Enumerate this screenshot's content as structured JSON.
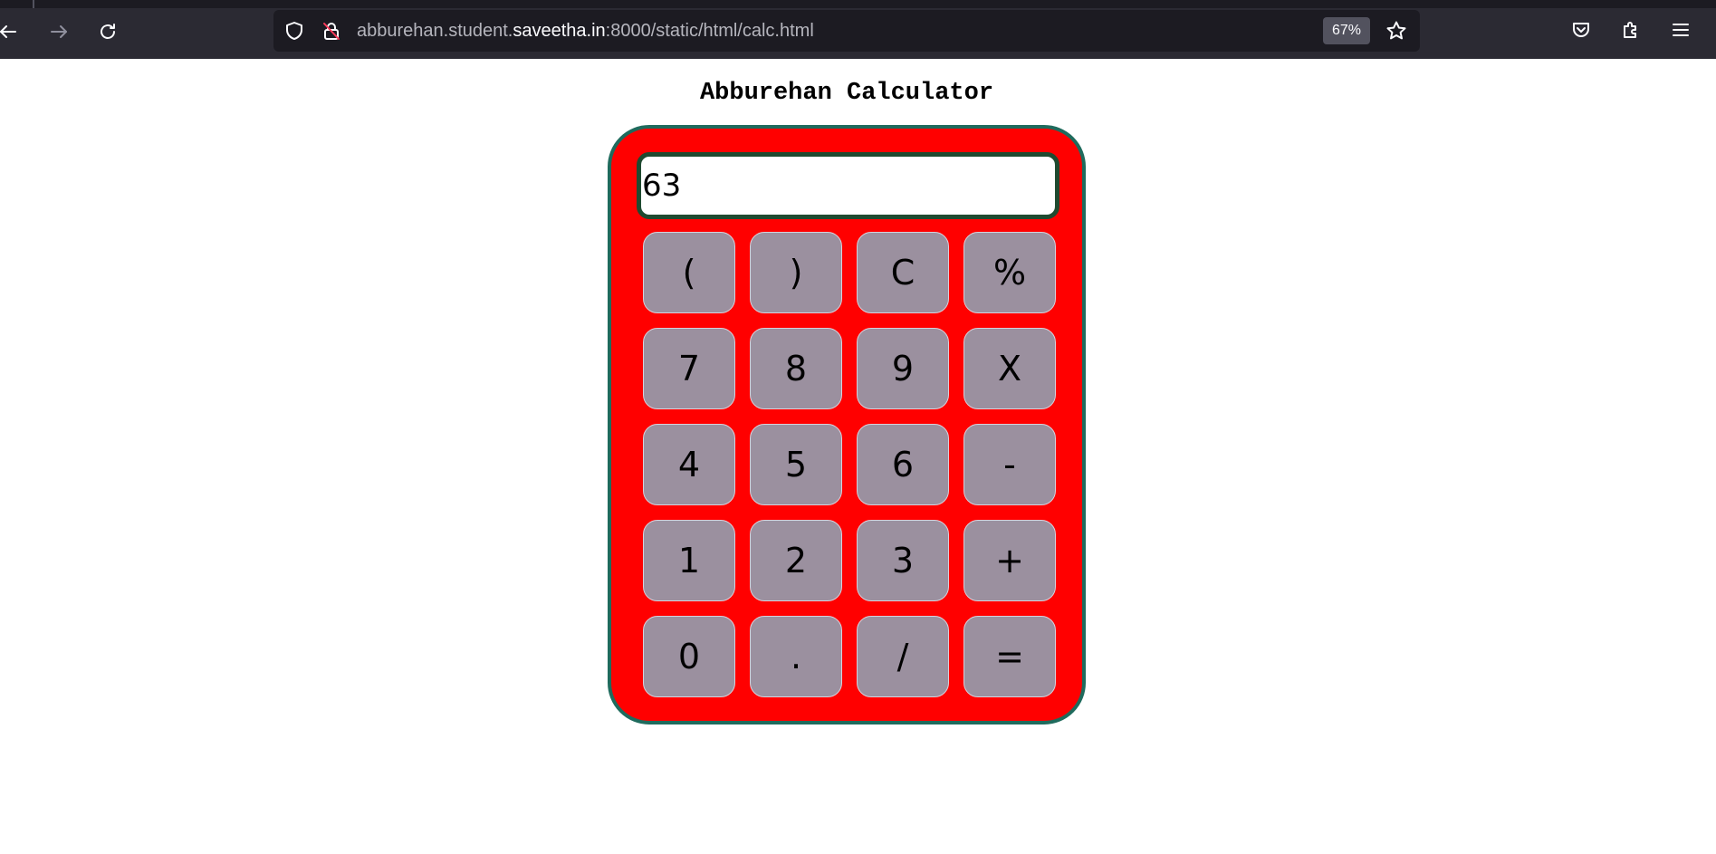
{
  "browser": {
    "url_prefix": "abburehan.student.",
    "url_host": "saveetha.in",
    "url_suffix": ":8000/static/html/calc.html",
    "zoom": "67%"
  },
  "page": {
    "title": "Abburehan Calculator"
  },
  "calculator": {
    "display_value": "63",
    "keys": [
      {
        "label": "(",
        "name": "open-paren-button"
      },
      {
        "label": ")",
        "name": "close-paren-button"
      },
      {
        "label": "C",
        "name": "clear-button"
      },
      {
        "label": "%",
        "name": "percent-button"
      },
      {
        "label": "7",
        "name": "digit-7-button"
      },
      {
        "label": "8",
        "name": "digit-8-button"
      },
      {
        "label": "9",
        "name": "digit-9-button"
      },
      {
        "label": "X",
        "name": "multiply-button"
      },
      {
        "label": "4",
        "name": "digit-4-button"
      },
      {
        "label": "5",
        "name": "digit-5-button"
      },
      {
        "label": "6",
        "name": "digit-6-button"
      },
      {
        "label": "-",
        "name": "subtract-button"
      },
      {
        "label": "1",
        "name": "digit-1-button"
      },
      {
        "label": "2",
        "name": "digit-2-button"
      },
      {
        "label": "3",
        "name": "digit-3-button"
      },
      {
        "label": "+",
        "name": "add-button"
      },
      {
        "label": "0",
        "name": "digit-0-button"
      },
      {
        "label": ".",
        "name": "decimal-point-button"
      },
      {
        "label": "/",
        "name": "divide-button"
      },
      {
        "label": "=",
        "name": "equals-button"
      }
    ]
  },
  "colors": {
    "calculator_body": "#ff0000",
    "calculator_border": "#1f6b5d",
    "key_background": "#9b909f",
    "toolbar": "#2b2a33"
  }
}
